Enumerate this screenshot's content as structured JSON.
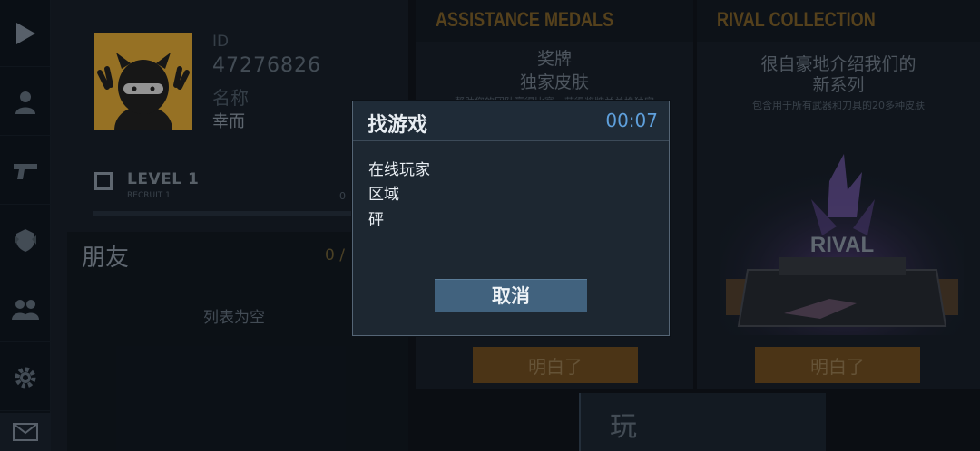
{
  "sidebar": {
    "items": [
      {
        "icon": "play-icon"
      },
      {
        "icon": "profile-icon"
      },
      {
        "icon": "pistol-icon"
      },
      {
        "icon": "rank-emblem-icon"
      },
      {
        "icon": "friends-icon"
      },
      {
        "icon": "gear-icon"
      },
      {
        "icon": "mail-icon"
      }
    ]
  },
  "profile": {
    "id_label": "ID",
    "id_value": "47276826",
    "name_label": "名称",
    "name_value": "幸而",
    "level_title": "LEVEL 1",
    "level_subtitle": "RECRUIT 1",
    "level_progress_text": "0",
    "level_progress": 0
  },
  "friends": {
    "title": "朋友",
    "count": "0 /",
    "empty_text": "列表为空"
  },
  "medals_panel": {
    "header": "ASSISTANCE MEDALS",
    "title_line1": "奖牌",
    "title_line2": "独家皮肤",
    "description": "帮助您的团队赢得比赛，获得奖牌并兑换独家",
    "got_it": "明白了"
  },
  "rival_panel": {
    "header": "RIVAL COLLECTION",
    "title_line1": "很自豪地介绍我们的",
    "title_line2": "新系列",
    "description": "包含用于所有武器和刀具的20多种皮肤",
    "logo_text": "RIVAL",
    "got_it": "明白了"
  },
  "play": {
    "label": "玩"
  },
  "dialog": {
    "title": "找游戏",
    "timer": "00:07",
    "lines": [
      "在线玩家",
      "区域",
      "砰"
    ],
    "cancel": "取消"
  },
  "colors": {
    "accent_orange": "#d28a2a",
    "timer_blue": "#5fa0dc",
    "cancel_button": "#41627e"
  }
}
